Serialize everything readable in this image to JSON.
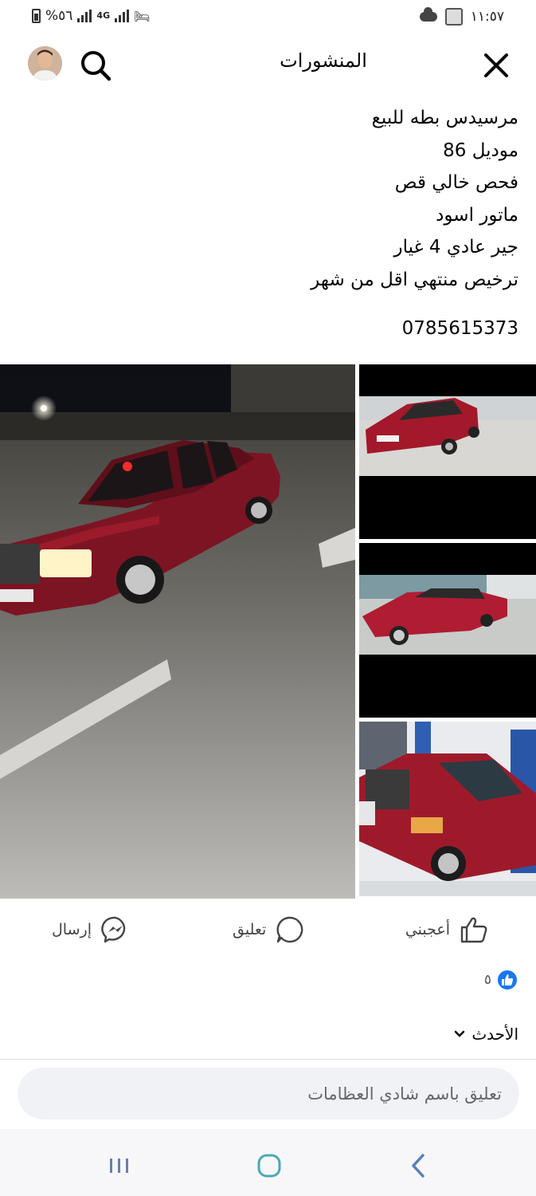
{
  "status_bar": {
    "battery": "%٥٦",
    "network": "4G",
    "time": "١١:٥٧"
  },
  "header": {
    "title": "المنشورات",
    "icons": {
      "search": "search-icon",
      "close": "close-icon",
      "avatar": "avatar"
    }
  },
  "post": {
    "lines": [
      "مرسيدس بطه للبيع",
      "موديل 86",
      "فحص خالي قص",
      "ماتور اسود",
      "جير عادي 4 غيار",
      "ترخيص منتهي اقل من شهر"
    ],
    "phone": "0785615373"
  },
  "photos": {
    "main": "red-mercedes-night-photo",
    "thumbs": [
      "red-mercedes-rear-photo",
      "red-mercedes-side-photo",
      "red-mercedes-front-photo"
    ]
  },
  "actions": {
    "like": "أعجبني",
    "comment": "تعليق",
    "send": "إرسال"
  },
  "reactions": {
    "count": "٥"
  },
  "sort": {
    "label": "الأحدث"
  },
  "comment_box": {
    "placeholder": "تعليق باسم شادي العظامات"
  },
  "colors": {
    "brand": "#1877f2",
    "text": "#050505",
    "input_bg": "#f0f2f5",
    "car_red": "#9b1b2a"
  }
}
